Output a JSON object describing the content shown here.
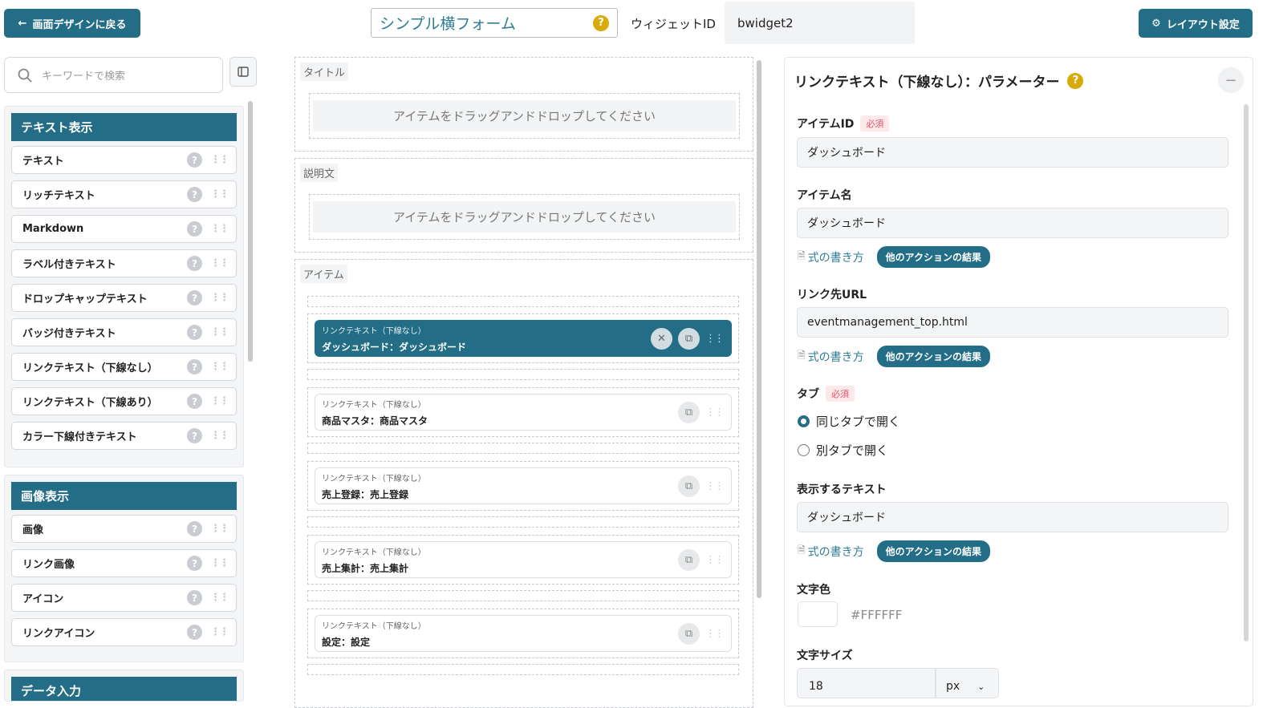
{
  "header": {
    "back_label": "画面デザインに戻る",
    "widget_title": "シンプル横フォーム",
    "widget_id_label": "ウィジェットID",
    "widget_id_value": "bwidget2",
    "layout_label": "レイアウト設定"
  },
  "palette": {
    "search_placeholder": "キーワードで検索",
    "categories": [
      {
        "title": "テキスト表示",
        "items": [
          "テキスト",
          "リッチテキスト",
          "Markdown",
          "ラベル付きテキスト",
          "ドロップキャップテキスト",
          "バッジ付きテキスト",
          "リンクテキスト（下線なし）",
          "リンクテキスト（下線あり）",
          "カラー下線付きテキスト"
        ]
      },
      {
        "title": "画像表示",
        "items": [
          "画像",
          "リンク画像",
          "アイコン",
          "リンクアイコン"
        ]
      },
      {
        "title": "データ入力",
        "items": []
      }
    ]
  },
  "canvas": {
    "sections": [
      {
        "label": "タイトル",
        "drop_text": "アイテムをドラッグアンドドロップしてください"
      },
      {
        "label": "説明文",
        "drop_text": "アイテムをドラッグアンドドロップしてください"
      },
      {
        "label": "アイテム"
      }
    ],
    "cards": [
      {
        "type": "リンクテキスト（下線なし）",
        "text": "ダッシュボード：ダッシュボード",
        "selected": true
      },
      {
        "type": "リンクテキスト（下線なし）",
        "text": "商品マスタ：商品マスタ",
        "selected": false
      },
      {
        "type": "リンクテキスト（下線なし）",
        "text": "売上登録：売上登録",
        "selected": false
      },
      {
        "type": "リンクテキスト（下線なし）",
        "text": "売上集計：売上集計",
        "selected": false
      },
      {
        "type": "リンクテキスト（下線なし）",
        "text": "設定：設定",
        "selected": false
      }
    ]
  },
  "props": {
    "title": "リンクテキスト（下線なし）：パラメーター",
    "item_id": {
      "label": "アイテムID",
      "required": "必須",
      "value": "ダッシュボード"
    },
    "item_name": {
      "label": "アイテム名",
      "value": "ダッシュボード"
    },
    "link_url": {
      "label": "リンク先URL",
      "value": "eventmanagement_top.html"
    },
    "tab": {
      "label": "タブ",
      "required": "必須",
      "options": [
        "同じタブで開く",
        "別タブで開く"
      ],
      "selected": "同じタブで開く"
    },
    "display_text": {
      "label": "表示するテキスト",
      "value": "ダッシュボード"
    },
    "text_color": {
      "label": "文字色",
      "value": "#FFFFFF"
    },
    "text_size": {
      "label": "文字サイズ",
      "value": "18",
      "unit": "px"
    },
    "formula_link": "式の書き方",
    "other_action": "他のアクションの結果"
  },
  "colors": {
    "accent": "#236e86",
    "help": "#d8aa0a",
    "required": "#e5546a"
  }
}
